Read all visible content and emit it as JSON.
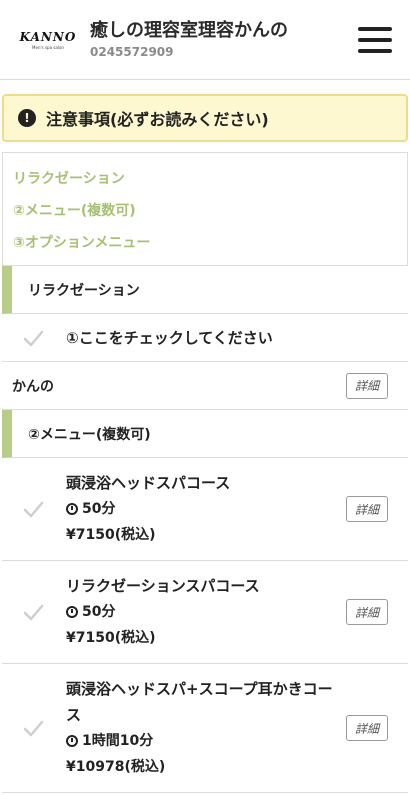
{
  "header": {
    "logo_text": "KANNO",
    "logo_tagline": "Men's spa salon",
    "title": "癒しの理容室理容かんの",
    "phone": "0245572909"
  },
  "notice": {
    "icon": "!",
    "text": "注意事項(必ずお読みください)"
  },
  "toc": {
    "items": [
      "リラクゼーション",
      "②メニュー(複数可)",
      "③オプションメニュー"
    ]
  },
  "sections": {
    "relax": {
      "title": "リラクゼーション",
      "check_label": "①ここをチェックしてください",
      "staff_label": "かんの",
      "detail_label": "詳細"
    },
    "menu": {
      "title": "②メニュー(複数可)",
      "items": [
        {
          "name": "頭浸浴ヘッドスパコース",
          "time": "50分",
          "price": "¥7150(税込)",
          "detail": "詳細"
        },
        {
          "name": "リラクゼーションスパコース",
          "time": "50分",
          "price": "¥7150(税込)",
          "detail": "詳細"
        },
        {
          "name": "頭浸浴ヘッドスパ+スコープ耳かきコース",
          "time": "1時間10分",
          "price": "¥10978(税込)",
          "detail": "詳細"
        }
      ]
    }
  }
}
